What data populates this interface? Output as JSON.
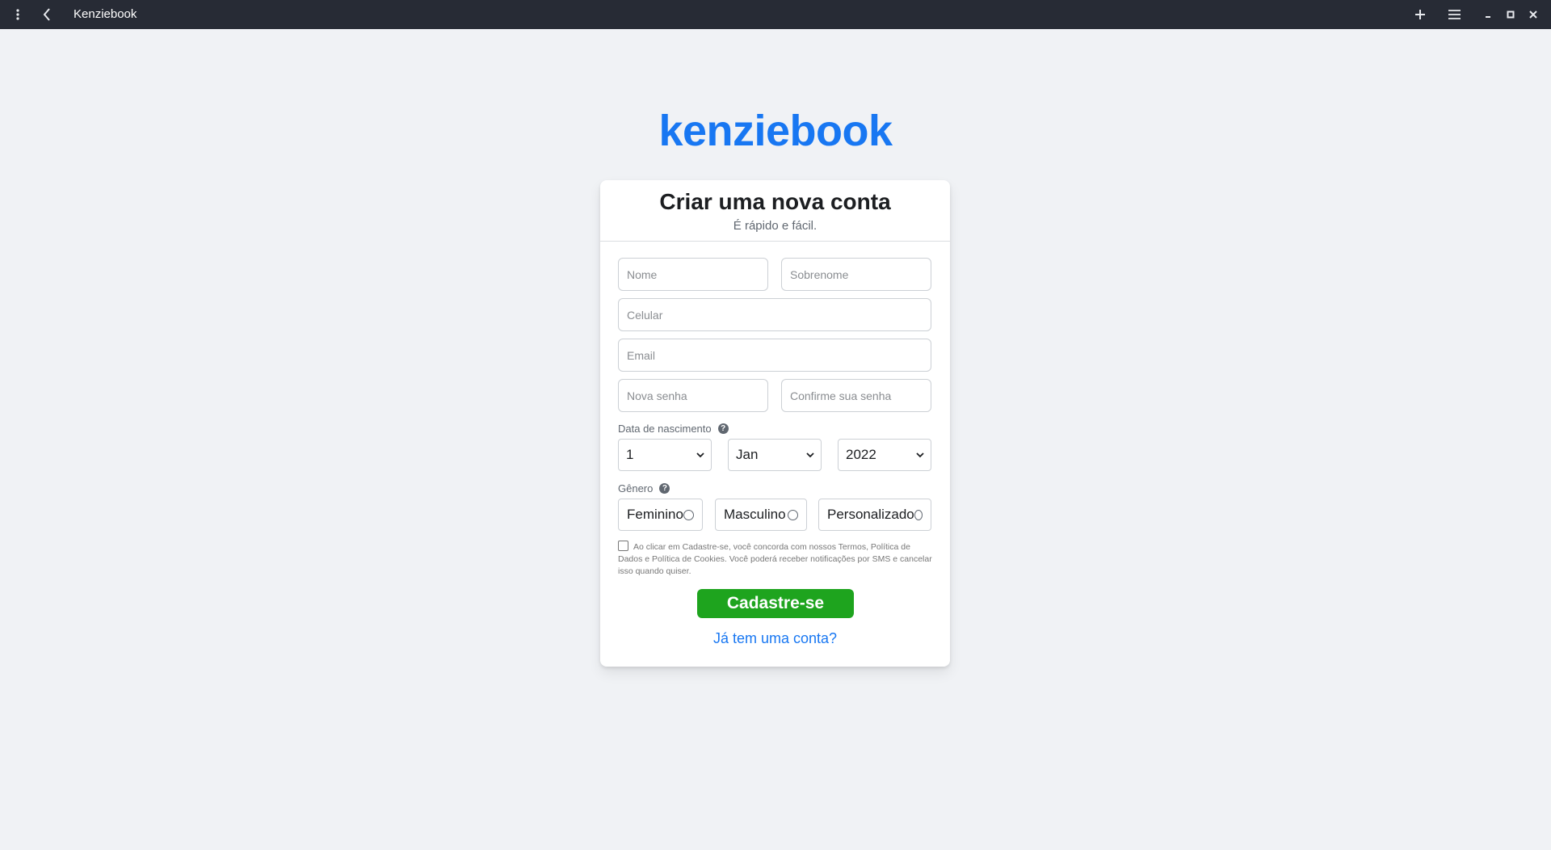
{
  "window": {
    "title": "Kenziebook",
    "icons": {
      "menu": "kebab-menu-icon",
      "back": "chevron-left-icon",
      "new_tab": "plus-icon",
      "hamburger": "hamburger-icon",
      "minimize": "minimize-icon",
      "maximize": "maximize-icon",
      "close": "close-icon"
    }
  },
  "brand": {
    "logo_text": "kenziebook",
    "color": "#1877f2"
  },
  "card": {
    "title": "Criar uma nova conta",
    "subtitle": "É rápido e fácil."
  },
  "form": {
    "first_name_placeholder": "Nome",
    "last_name_placeholder": "Sobrenome",
    "phone_placeholder": "Celular",
    "email_placeholder": "Email",
    "password_placeholder": "Nova senha",
    "confirm_password_placeholder": "Confirme sua senha",
    "birthdate": {
      "label": "Data de nascimento",
      "help_icon": "?",
      "day": "1",
      "month": "Jan",
      "year": "2022"
    },
    "gender": {
      "label": "Gênero",
      "help_icon": "?",
      "options": [
        "Feminino",
        "Masculino",
        "Personalizado"
      ]
    },
    "terms_text": "Ao clicar em Cadastre-se, você concorda com nossos Termos, Política de Dados e Política de Cookies. Você poderá receber notificações por SMS e cancelar isso quando quiser.",
    "submit_label": "Cadastre-se",
    "submit_color": "#1ea41e",
    "login_link": "Já tem uma conta?"
  }
}
